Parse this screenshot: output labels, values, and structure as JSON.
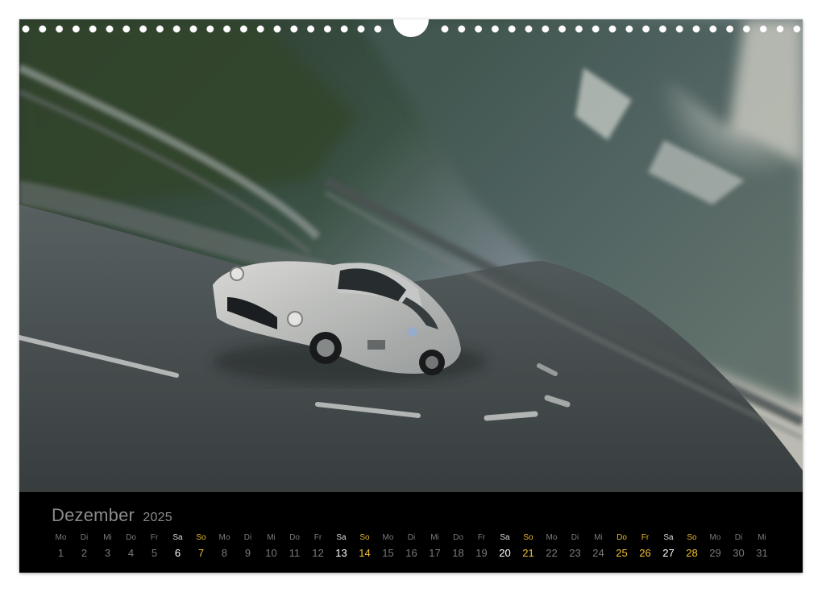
{
  "calendar": {
    "month": "Dezember",
    "year": "2025",
    "days": [
      {
        "wd": "Mo",
        "n": "1",
        "t": "w"
      },
      {
        "wd": "Di",
        "n": "2",
        "t": "w"
      },
      {
        "wd": "Mi",
        "n": "3",
        "t": "w"
      },
      {
        "wd": "Do",
        "n": "4",
        "t": "w"
      },
      {
        "wd": "Fr",
        "n": "5",
        "t": "w"
      },
      {
        "wd": "Sa",
        "n": "6",
        "t": "sa"
      },
      {
        "wd": "So",
        "n": "7",
        "t": "so"
      },
      {
        "wd": "Mo",
        "n": "8",
        "t": "w"
      },
      {
        "wd": "Di",
        "n": "9",
        "t": "w"
      },
      {
        "wd": "Mi",
        "n": "10",
        "t": "w"
      },
      {
        "wd": "Do",
        "n": "11",
        "t": "w"
      },
      {
        "wd": "Fr",
        "n": "12",
        "t": "w"
      },
      {
        "wd": "Sa",
        "n": "13",
        "t": "sa"
      },
      {
        "wd": "So",
        "n": "14",
        "t": "so"
      },
      {
        "wd": "Mo",
        "n": "15",
        "t": "w"
      },
      {
        "wd": "Di",
        "n": "16",
        "t": "w"
      },
      {
        "wd": "Mi",
        "n": "17",
        "t": "w"
      },
      {
        "wd": "Do",
        "n": "18",
        "t": "w"
      },
      {
        "wd": "Fr",
        "n": "19",
        "t": "w"
      },
      {
        "wd": "Sa",
        "n": "20",
        "t": "sa"
      },
      {
        "wd": "So",
        "n": "21",
        "t": "so"
      },
      {
        "wd": "Mo",
        "n": "22",
        "t": "w"
      },
      {
        "wd": "Di",
        "n": "23",
        "t": "w"
      },
      {
        "wd": "Mi",
        "n": "24",
        "t": "w"
      },
      {
        "wd": "Do",
        "n": "25",
        "t": "hol"
      },
      {
        "wd": "Fr",
        "n": "26",
        "t": "hol"
      },
      {
        "wd": "Sa",
        "n": "27",
        "t": "sa"
      },
      {
        "wd": "So",
        "n": "28",
        "t": "so"
      },
      {
        "wd": "Mo",
        "n": "29",
        "t": "w"
      },
      {
        "wd": "Di",
        "n": "30",
        "t": "w"
      },
      {
        "wd": "Mi",
        "n": "31",
        "t": "w"
      }
    ]
  },
  "colors": {
    "weekday": "#7a7a7a",
    "saturday": "#ffffff",
    "sunday_holiday": "#f0c030",
    "strip_background": "#000000"
  }
}
